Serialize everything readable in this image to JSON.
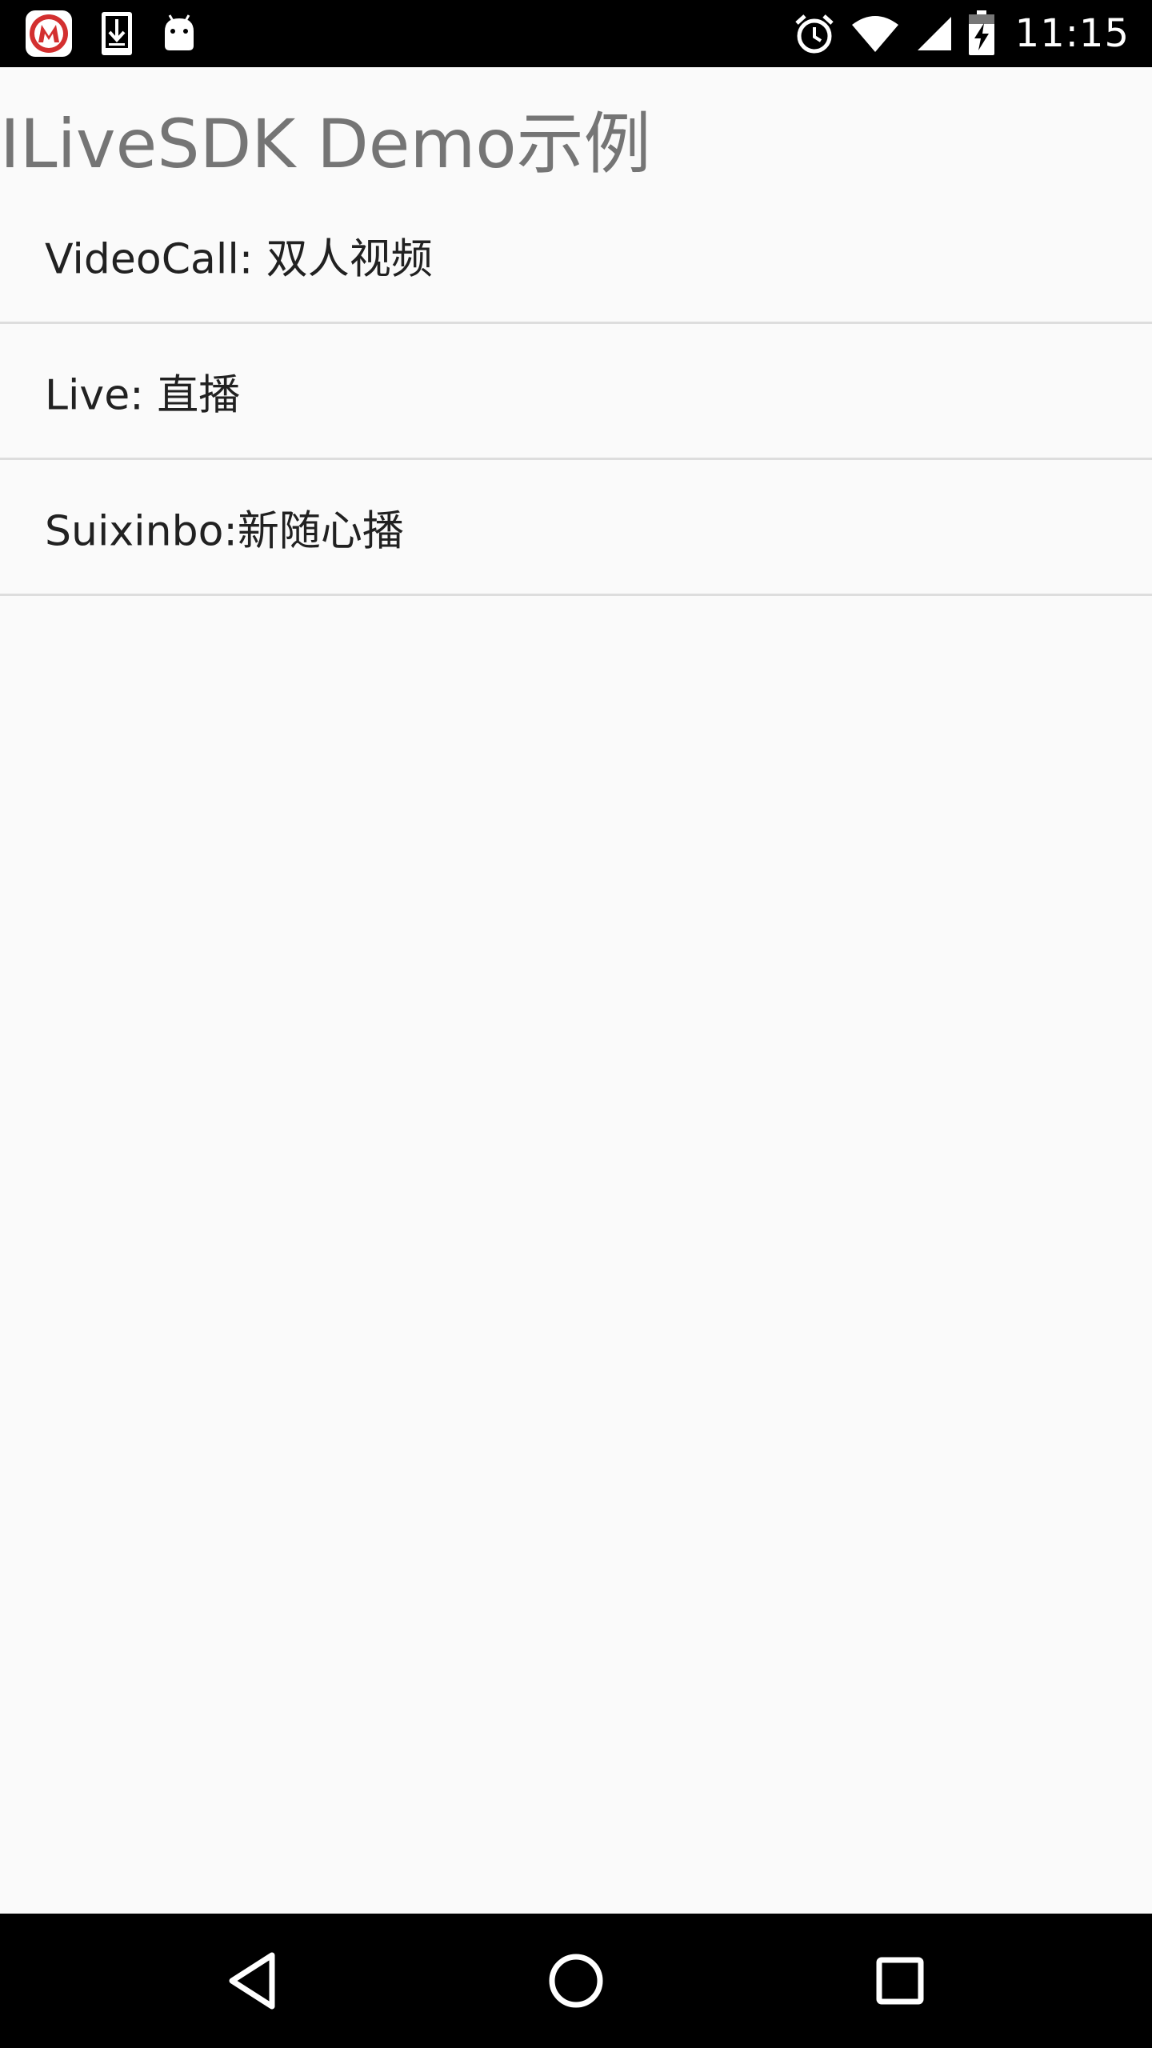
{
  "status_bar": {
    "time": "11:15",
    "notification_icons": [
      "app-logo-icon",
      "download-icon",
      "android-icon"
    ],
    "system_icons": [
      "alarm-icon",
      "wifi-icon",
      "signal-icon",
      "battery-charging-icon"
    ],
    "accent_logo_color": "#d32f2f"
  },
  "app": {
    "title": "ILiveSDK Demo示例",
    "title_color": "#757575"
  },
  "menu": {
    "items": [
      {
        "label": "VideoCall: 双人视频"
      },
      {
        "label": "Live: 直播"
      },
      {
        "label": "Suixinbo:新随心播"
      }
    ]
  },
  "nav_bar": {
    "buttons": [
      "back-icon",
      "home-icon",
      "recents-icon"
    ]
  }
}
